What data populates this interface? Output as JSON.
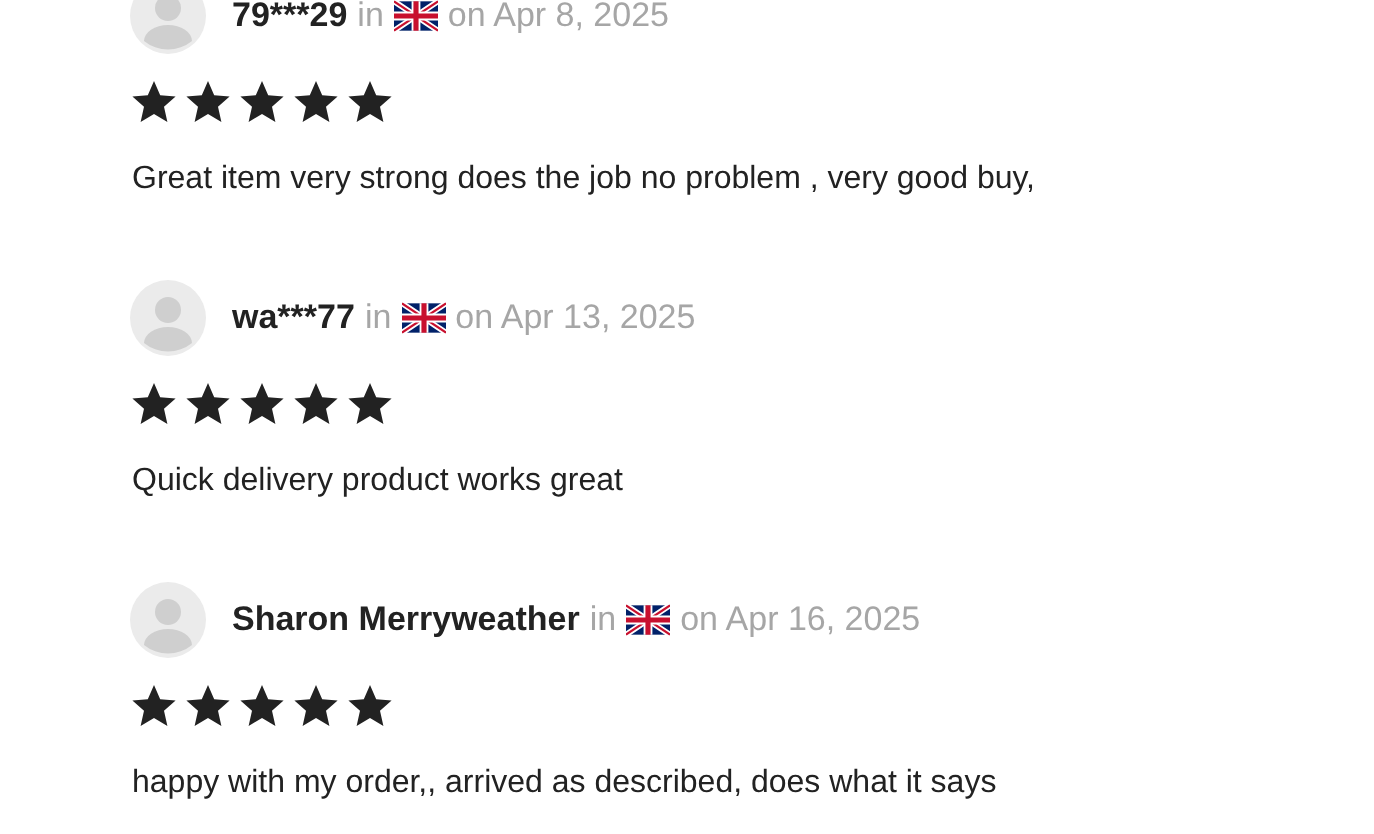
{
  "reviews": [
    {
      "user": "79***29",
      "in_label": "in",
      "date": "on Apr 8, 2025",
      "stars": 5,
      "text": "Great item very strong does the job no problem , very good buy,"
    },
    {
      "user": "wa***77",
      "in_label": "in",
      "date": "on Apr 13, 2025",
      "stars": 5,
      "text": "Quick delivery product works great"
    },
    {
      "user": "Sharon Merryweather",
      "in_label": "in",
      "date": "on Apr 16, 2025",
      "stars": 5,
      "text": "happy with my order,, arrived as described, does what it says"
    }
  ]
}
